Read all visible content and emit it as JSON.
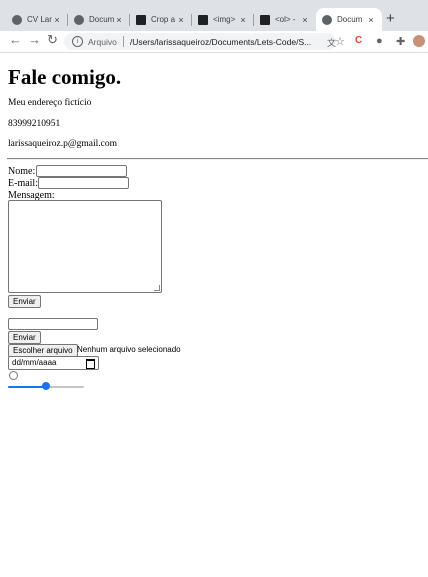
{
  "browser": {
    "tabs": [
      {
        "title": "CV Lar",
        "close": "×",
        "favicon_color": "#5f6368"
      },
      {
        "title": "Docum",
        "close": "×",
        "favicon_color": "#5f6368"
      },
      {
        "title": "Crop a",
        "close": "×",
        "favicon_color": "#202124"
      },
      {
        "title": "<img>",
        "close": "×",
        "favicon_color": "#202124"
      },
      {
        "title": "<ol> -",
        "close": "×",
        "favicon_color": "#202124"
      },
      {
        "title": "Docum",
        "close": "×",
        "favicon_color": "#5f6368"
      }
    ],
    "new_tab": "+",
    "back": "←",
    "forward": "→",
    "reload": "↻",
    "security_label": "Arquivo",
    "url": "/Users/larissaqueiroz/Documents/Lets-Code/S..."
  },
  "page": {
    "heading": "Fale comigo.",
    "address": "Meu endereço fictício",
    "phone": "83999210951",
    "email": "larissaqueiroz.p@gmail.com",
    "form": {
      "name_label": "Nome:",
      "email_label": "E-mail:",
      "message_label": "Mensagem:",
      "submit_label": "Enviar",
      "submit2_label": "Enviar",
      "file_button_label": "Escolher arquivo",
      "file_status": "Nenhum arquivo selecionado",
      "date_placeholder": "dd/mm/aaaa",
      "range_value_fraction": 0.5
    }
  },
  "colors": {
    "accent": "#1a73e8",
    "tabbar_bg": "#dee1e6"
  }
}
